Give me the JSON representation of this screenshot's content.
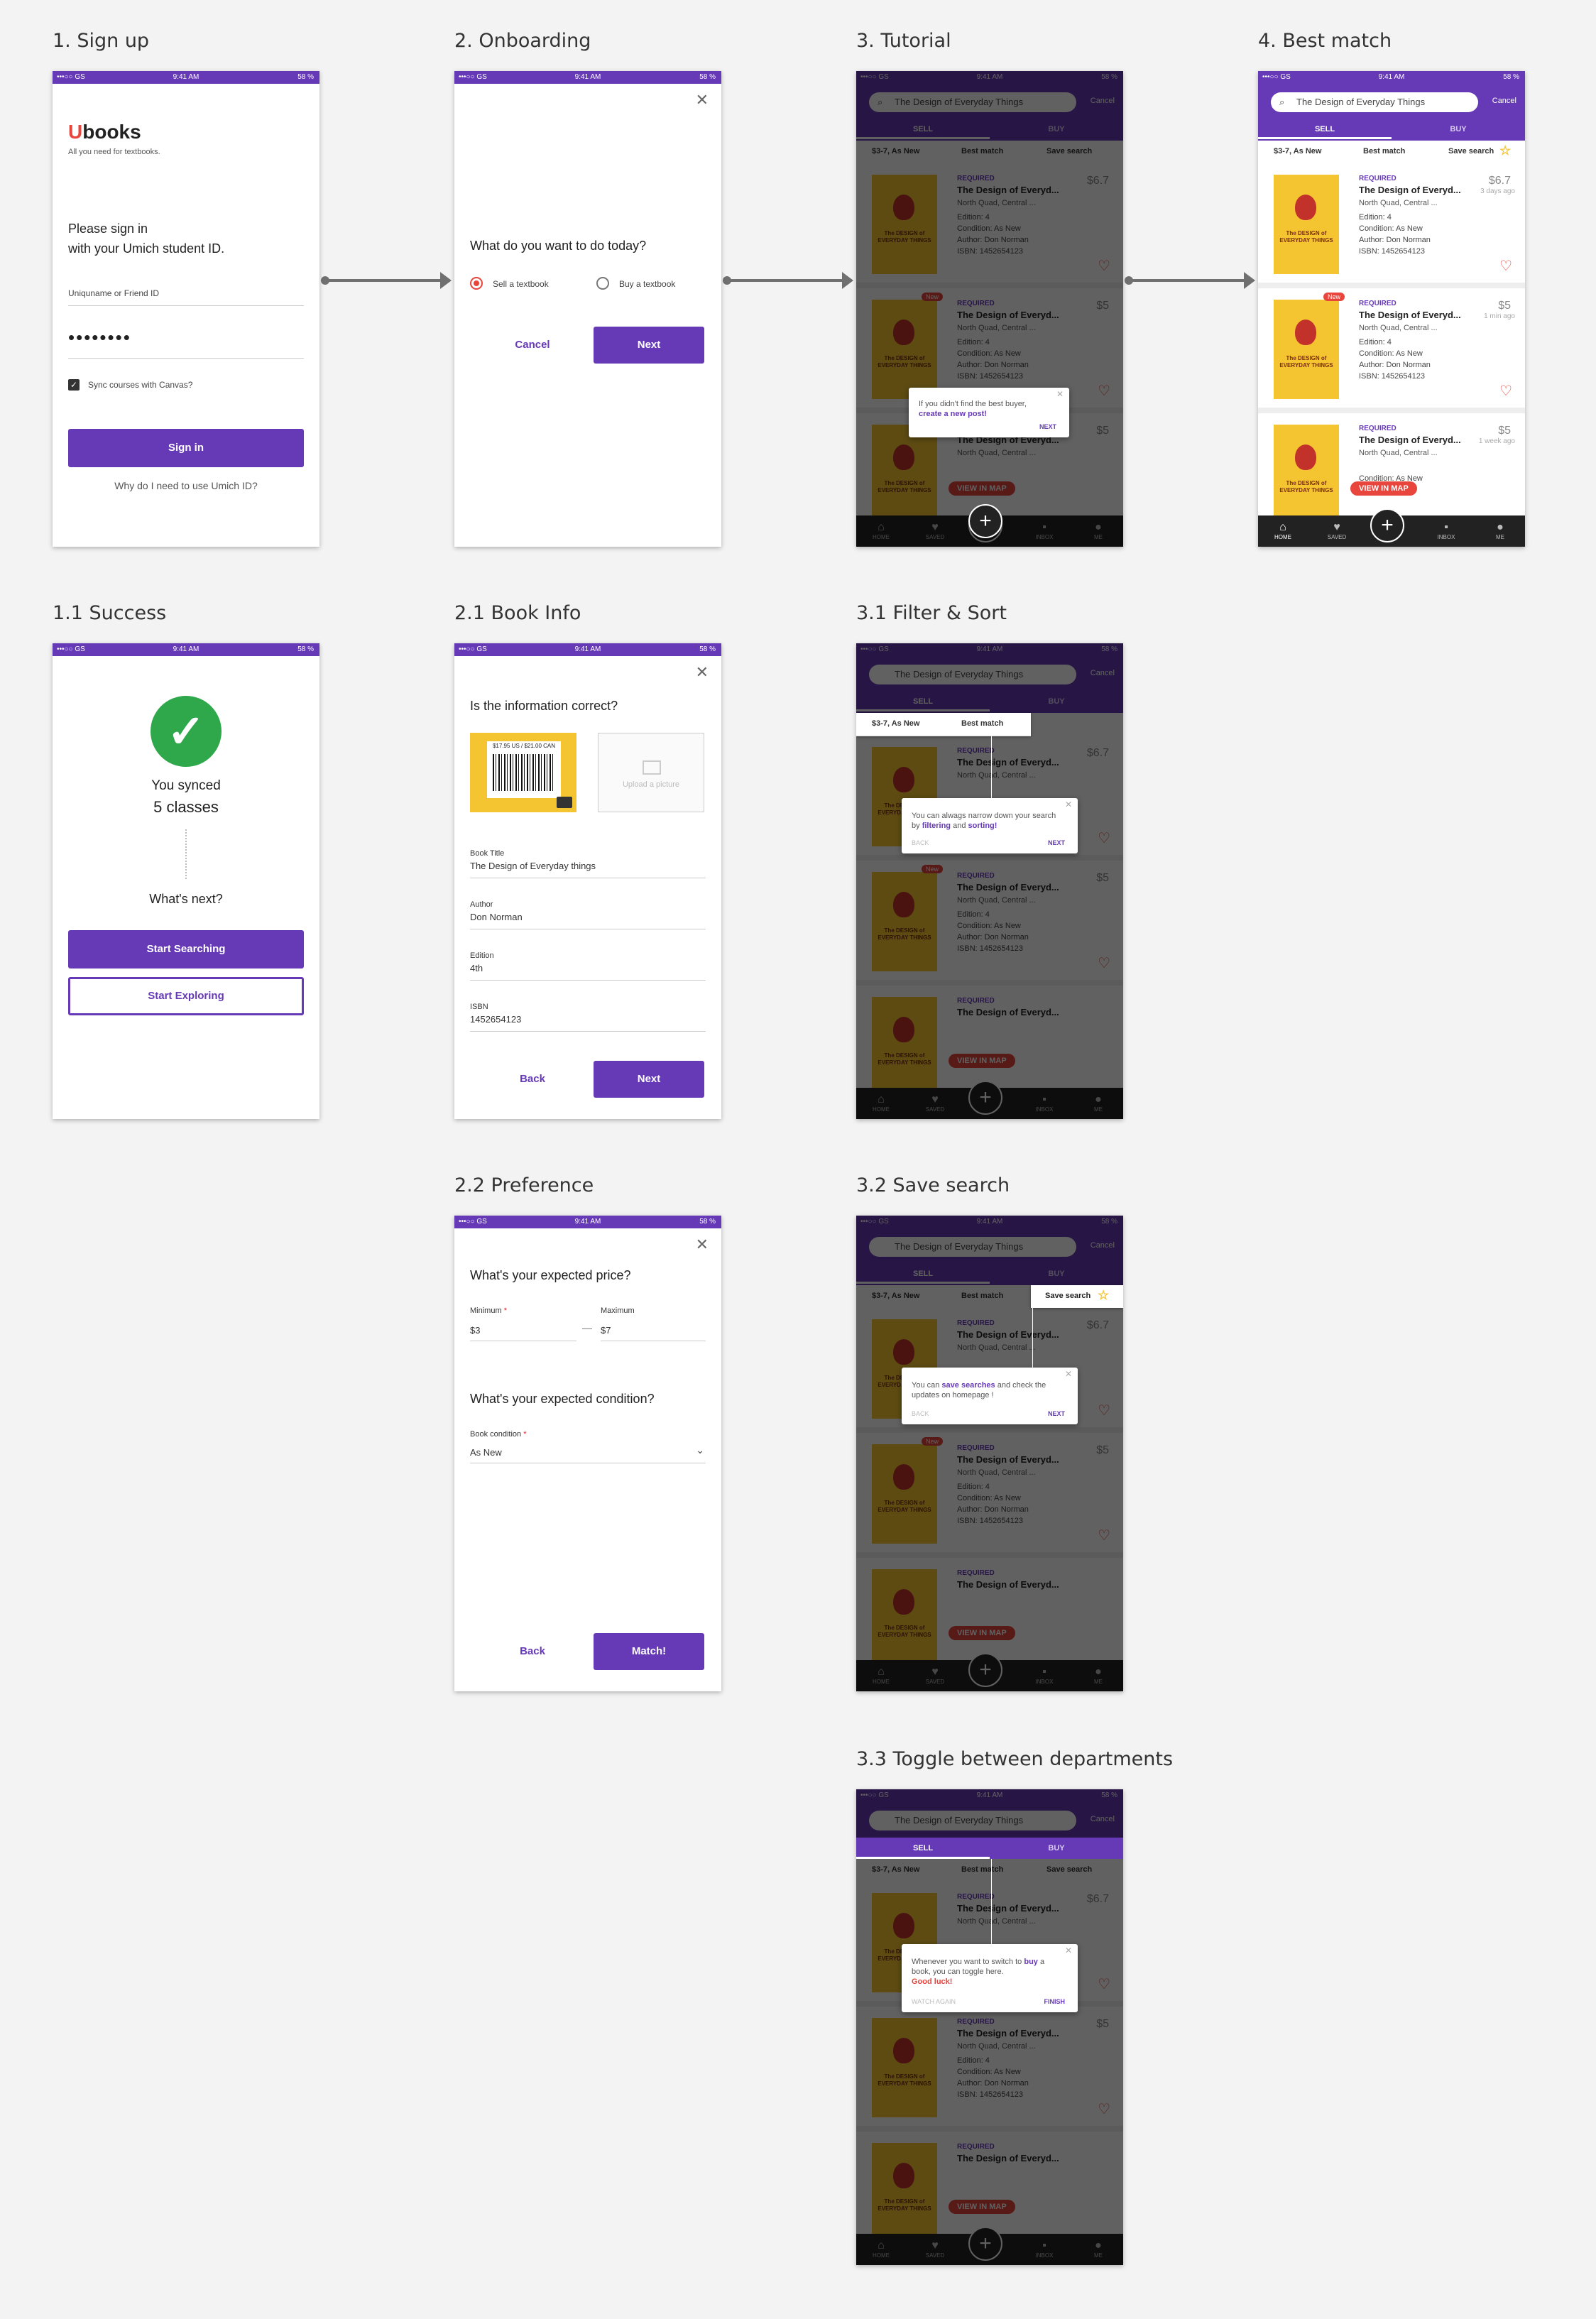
{
  "colors": {
    "accent": "#6639b7",
    "red": "#e8453c",
    "yellow": "#f5c531",
    "green": "#2ea84a"
  },
  "status": {
    "left": "•••○○ GS ",
    "time": "9:41 AM",
    "right": "58 %"
  },
  "labels": {
    "s1": "1. Sign up",
    "s2": "2. Onboarding",
    "s3": "3. Tutorial",
    "s4": "4. Best match",
    "s11": "1.1 Success",
    "s21": "2.1 Book Info",
    "s31": "3.1 Filter & Sort",
    "s22": "2.2 Preference",
    "s32": "3.2 Save search",
    "s33": "3.3 Toggle between departments"
  },
  "signup": {
    "logo_u": "U",
    "logo_rest": "books",
    "tagline": "All you need for textbooks.",
    "prompt1": "Please sign in",
    "prompt2": "with your Umich student ID.",
    "username_placeholder": "Uniquname or Friend ID",
    "password_dots": "••••••••",
    "sync_label": "Sync courses with Canvas?",
    "signin_btn": "Sign in",
    "why_link": "Why do I need to use Umich ID?"
  },
  "onboarding": {
    "question": "What do you want to do today?",
    "sell_option": "Sell a textbook",
    "buy_option": "Buy a textbook",
    "cancel_btn": "Cancel",
    "next_btn": "Next"
  },
  "success": {
    "line1": "You synced",
    "line2": "5 classes",
    "whats_next": "What's next?",
    "start_searching": "Start Searching",
    "start_exploring": "Start Exploring"
  },
  "bookinfo": {
    "question": "Is the information correct?",
    "barcode_price": "$17.95 US / $21.00 CAN",
    "upload": "Upload a picture",
    "title_label": "Book Title",
    "title_value": "The Design of Everyday things",
    "author_label": "Author",
    "author_value": "Don Norman",
    "edition_label": "Edition",
    "edition_value": "4th",
    "isbn_label": "ISBN",
    "isbn_value": "1452654123",
    "back_btn": "Back",
    "next_btn": "Next"
  },
  "preference": {
    "price_q": "What's your expected price?",
    "min_label": "Minimum",
    "min_value": "$3",
    "max_label": "Maximum",
    "max_value": "$7",
    "dash": "—",
    "cond_q": "What's your expected condition?",
    "cond_label": "Book condition",
    "cond_value": "As New",
    "back_btn": "Back",
    "match_btn": "Match!"
  },
  "listing": {
    "search_text": "The Design of Everyday Things",
    "cancel": "Cancel",
    "tab_sell": "SELL",
    "tab_buy": "BUY",
    "filter1": "$3-7, As New",
    "filter2": "Best match",
    "filter3": "Save search",
    "nav": [
      "HOME",
      "SAVED",
      "INBOX",
      "ME"
    ],
    "view_map": "VIEW IN MAP",
    "cover_title": "The DESIGN of EVERYDAY THINGS",
    "cards": [
      {
        "req": "REQUIRED",
        "title": "The Design of Everyd...",
        "loc": "North Quad, Central ...",
        "price": "$6.7",
        "ago": "3 days ago",
        "edition": "Edition:  4",
        "condition": "Condition:  As New",
        "author": "Author:  Don Norman",
        "isbn": "ISBN:  1452654123"
      },
      {
        "req": "REQUIRED",
        "title": "The Design of Everyd...",
        "loc": "North Quad, Central ...",
        "price": "$5",
        "ago": "1 min ago",
        "badge": "New",
        "edition": "Edition:  4",
        "condition": "Condition:  As New",
        "author": "Author:  Don Norman",
        "isbn": "ISBN:  1452654123"
      },
      {
        "req": "REQUIRED",
        "title": "The Design of Everyd...",
        "loc": "North Quad, Central ...",
        "price": "$5",
        "ago": "1 week ago",
        "condition": "Condition:  As New",
        "author": "Author:  Don Norman"
      }
    ]
  },
  "tips": {
    "tutorial": {
      "pre": "If you didn't find the best buyer,",
      "link": "create a new post!",
      "next": "NEXT"
    },
    "filter": {
      "pre": "You can alwags narrow down your search by ",
      "a1": "filtering",
      "mid": " and ",
      "a2": "sorting!",
      "back": "BACK",
      "next": "NEXT"
    },
    "save": {
      "pre": "You can ",
      "a1": "save searches",
      "post": " and check the updates on homepage !",
      "back": "BACK",
      "next": "NEXT"
    },
    "toggle": {
      "pre": "Whenever you want to switch to ",
      "a1": "buy",
      "post": " a book, you can toggle here.",
      "luck": "Good luck!",
      "back": "WATCH AGAIN",
      "next": "FINISH"
    }
  }
}
